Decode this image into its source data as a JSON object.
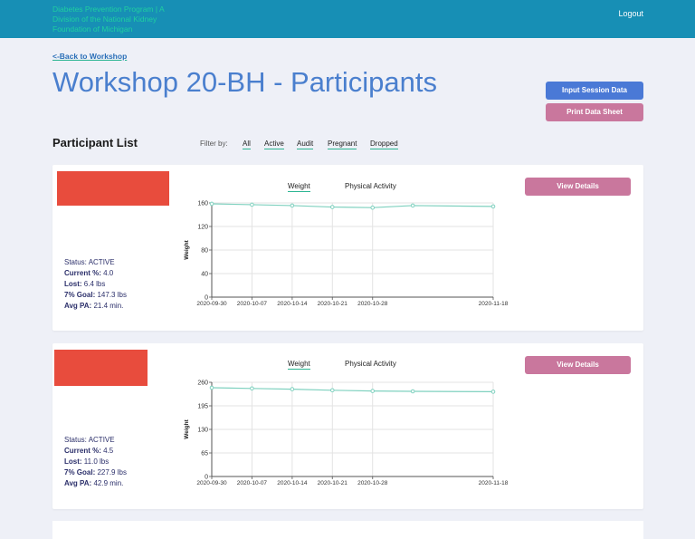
{
  "header": {
    "org_name": "Diabetes Prevention Program | A Division of the National Kidney Foundation of Michigan",
    "logout_label": "Logout"
  },
  "nav": {
    "back_label": "<-Back to Workshop"
  },
  "page": {
    "title": "Workshop 20-BH - Participants",
    "input_session_label": "Input Session Data",
    "print_sheet_label": "Print Data Sheet"
  },
  "list": {
    "title": "Participant List",
    "filter_label": "Filter by:",
    "filters": [
      "All",
      "Active",
      "Audit",
      "Pregnant",
      "Dropped"
    ]
  },
  "labels": {
    "status": "Status:",
    "current_pct": "Current %:",
    "lost": "Lost:",
    "goal": "7% Goal:",
    "avg_pa": "Avg PA:",
    "tab_weight": "Weight",
    "tab_pa": "Physical Activity",
    "view_details": "View Details"
  },
  "colors": {
    "header": "#178fb5",
    "accent_blue": "#4a79d6",
    "accent_pink": "#c9779d",
    "photo_placeholder": "#e84c3d",
    "line": "#7fd1bf"
  },
  "participants": [
    {
      "status": "ACTIVE",
      "current_pct": "4.0",
      "lost": "6.4 lbs",
      "goal": "147.3 lbs",
      "avg_pa": "21.4 min.",
      "chart_data": {
        "type": "line",
        "ylabel": "Weight",
        "ylim": [
          0,
          160
        ],
        "yticks": [
          "0",
          "40",
          "80",
          "120",
          "160"
        ],
        "xlabels": [
          "2020-09-30",
          "2020-10-07",
          "2020-10-14",
          "2020-10-21",
          "2020-10-28",
          "2020-11-18"
        ],
        "x": [
          "2020-09-30",
          "2020-10-07",
          "2020-10-14",
          "2020-10-21",
          "2020-10-28",
          "2020-11-04",
          "2020-11-18"
        ],
        "values": [
          158.5,
          157,
          155.5,
          153,
          152,
          155.5,
          154
        ]
      }
    },
    {
      "status": "ACTIVE",
      "current_pct": "4.5",
      "lost": "11.0 lbs",
      "goal": "227.9 lbs",
      "avg_pa": "42.9 min.",
      "chart_data": {
        "type": "line",
        "ylabel": "Weight",
        "ylim": [
          0,
          260
        ],
        "yticks": [
          "0",
          "65",
          "130",
          "195",
          "260"
        ],
        "xlabels": [
          "2020-09-30",
          "2020-10-07",
          "2020-10-14",
          "2020-10-21",
          "2020-10-28",
          "2020-11-18"
        ],
        "x": [
          "2020-09-30",
          "2020-10-07",
          "2020-10-14",
          "2020-10-21",
          "2020-10-28",
          "2020-11-04",
          "2020-11-18"
        ],
        "values": [
          245,
          243,
          241,
          238,
          236,
          235,
          234
        ]
      }
    }
  ]
}
